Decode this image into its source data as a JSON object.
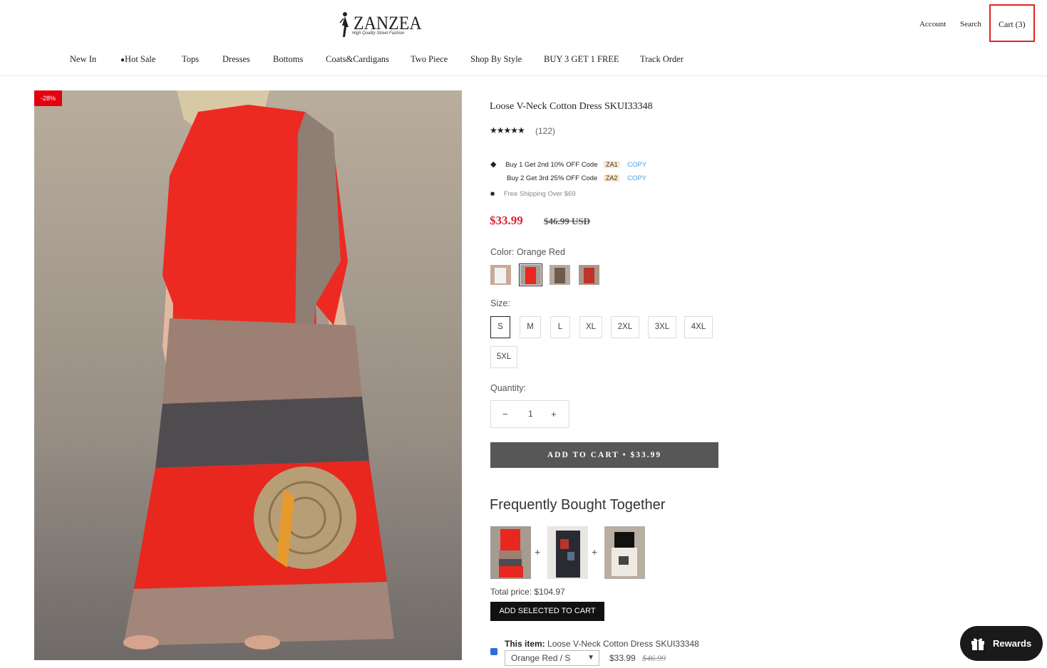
{
  "header": {
    "logo_text": "ZANZEA",
    "logo_subtitle": "High Quality Street Fashion",
    "account": "Account",
    "search": "Search",
    "cart": "Cart (3)"
  },
  "nav": {
    "items": [
      "New In",
      "Hot Sale",
      "Tops",
      "Dresses",
      "Bottoms",
      "Coats&Cardigans",
      "Two Piece",
      "Shop By Style",
      "BUY 3 GET 1 FREE",
      "Track Order"
    ]
  },
  "product": {
    "badge": "-28%",
    "title": "Loose V-Neck Cotton Dress SKUI33348",
    "stars": "★★★★★",
    "reviews": "(122)",
    "promo1_text": "Buy 1 Get 2nd 10% OFF Code",
    "promo1_code": "ZA1",
    "promo2_text": "Buy 2 Get 3rd 25% OFF Code",
    "promo2_code": "ZA2",
    "copy_label": "COPY",
    "shipping": "Free Shipping Over $69",
    "price": "$33.99",
    "compare_price": "$46.99 USD",
    "color_label": "Color: Orange Red",
    "size_label": "Size:",
    "sizes": [
      "S",
      "M",
      "L",
      "XL",
      "2XL",
      "3XL",
      "4XL",
      "5XL"
    ],
    "selected_size": "S",
    "quantity_label": "Quantity:",
    "quantity": "1",
    "qty_minus": "−",
    "qty_plus": "+",
    "add_to_cart": "ADD TO CART   •   $33.99"
  },
  "fbt": {
    "title": "Frequently Bought Together",
    "plus": "+",
    "total": "Total price: $104.97",
    "add_selected": "ADD SELECTED TO CART",
    "this_item_label": "This item:",
    "this_item_name": "Loose V-Neck Cotton Dress SKUI33348",
    "variant": "Orange Red / S",
    "price": "$33.99",
    "compare_price": "$46.99"
  },
  "rewards": {
    "label": "Rewards"
  },
  "colors": {
    "accent_red": "#d8262e",
    "cart_highlight": "#e02424",
    "button_gray": "#575757"
  }
}
